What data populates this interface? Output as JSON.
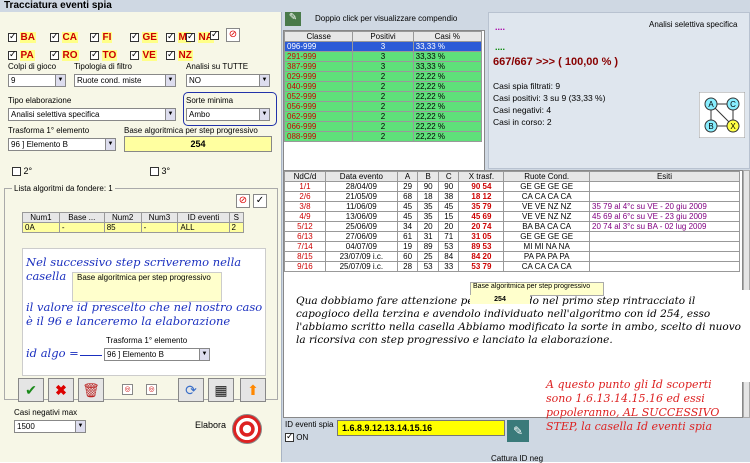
{
  "title": "Tracciatura eventi spia",
  "cities": [
    "BA",
    "CA",
    "FI",
    "GE",
    "MI",
    "NA",
    "PA",
    "RO",
    "TO",
    "VE",
    "NZ"
  ],
  "labels": {
    "colpi": "Colpi di gioco",
    "tipologia": "Tipologia di filtro",
    "analisi_tutte": "Analisi su TUTTE",
    "tipo_elab": "Tipo elaborazione",
    "sorte_min": "Sorte minima",
    "trasforma": "Trasforma 1° elemento",
    "base_alg": "Base algoritmica per step progressivo",
    "second": "2°",
    "third": "3°",
    "lista": "Lista algoritmi da fondere: 1",
    "casi_neg": "Casi negativi max",
    "elabora": "Elabora",
    "id_spia": "ID eventi spia",
    "on": "ON",
    "cattura": "Cattura ID neg",
    "dblclick": "Doppio click per visualizzare compendio",
    "analisi_sel": "Analisi selettiva specifica"
  },
  "values": {
    "colpi": "9",
    "tipologia": "Ruote cond. miste",
    "analisi_tutte": "NO",
    "tipo_elab": "Analisi selettiva specifica",
    "sorte": "Ambo",
    "trasforma": "96 ] Elemento B",
    "base": "254",
    "casi_neg": "1500",
    "id_spia": "1.6.8.9.12.13.14.15.16",
    "dots": "....",
    "result": "667/667 >>> ( 100,00 % )"
  },
  "stats": [
    "Casi spia filtrati: 9",
    "Casi positivi: 3 su 9 (33,33 %)",
    "Casi negativi: 4",
    "Casi in corso: 2"
  ],
  "algo_headers": [
    "Num1",
    "Base ...",
    "Num2",
    "Num3",
    "ID eventi",
    "S"
  ],
  "algo_row": [
    "0A",
    "-",
    "85",
    "-",
    "ALL",
    "2"
  ],
  "classe_headers": [
    "Classe",
    "Positivi",
    "Casi %"
  ],
  "classe_rows": [
    [
      "096-999",
      "3",
      "33,33 %"
    ],
    [
      "291-999",
      "3",
      "33,33 %"
    ],
    [
      "387-999",
      "3",
      "33,33 %"
    ],
    [
      "029-999",
      "2",
      "22,22 %"
    ],
    [
      "040-999",
      "2",
      "22,22 %"
    ],
    [
      "052-999",
      "2",
      "22,22 %"
    ],
    [
      "056-999",
      "2",
      "22,22 %"
    ],
    [
      "062-999",
      "2",
      "22,22 %"
    ],
    [
      "066-999",
      "2",
      "22,22 %"
    ],
    [
      "088-999",
      "2",
      "22,22 %"
    ]
  ],
  "ev_headers": [
    "NdC/d",
    "Data evento",
    "A",
    "B",
    "C",
    "X trasf.",
    "Ruote Cond.",
    "Esiti"
  ],
  "ev_rows": [
    [
      "1/1",
      "28/04/09",
      "29",
      "90",
      "90",
      "90 54",
      "GE GE GE GE",
      ""
    ],
    [
      "2/6",
      "21/05/09",
      "68",
      "18",
      "38",
      "18 12",
      "CA CA CA CA",
      ""
    ],
    [
      "3/8",
      "11/06/09",
      "45",
      "35",
      "45",
      "35 79",
      "VE VE NZ NZ",
      "35 79 al 4°c su VE - 20 giu 2009"
    ],
    [
      "4/9",
      "13/06/09",
      "45",
      "35",
      "15",
      "45 69",
      "VE VE NZ NZ",
      "45 69 al 6°c su VE - 23 giu 2009"
    ],
    [
      "5/12",
      "25/06/09",
      "34",
      "20",
      "20",
      "20 74",
      "BA BA CA CA",
      "20 74 al 3°c su BA - 02 lug 2009"
    ],
    [
      "6/13",
      "27/06/09",
      "61",
      "31",
      "71",
      "31 05",
      "GE GE GE GE",
      ""
    ],
    [
      "7/14",
      "04/07/09",
      "19",
      "89",
      "53",
      "89 53",
      "MI MI NA NA",
      ""
    ],
    [
      "8/15",
      "23/07/09 i.c.",
      "60",
      "25",
      "84",
      "84 20",
      "PA PA PA PA",
      ""
    ],
    [
      "9/16",
      "25/07/09 i.c.",
      "28",
      "53",
      "33",
      "53 79",
      "CA CA CA CA",
      ""
    ]
  ],
  "notes": {
    "left1": "Nel successivo step scriveremo nella casella",
    "left_base": "Base algoritmica per step progressivo",
    "left2": "il valore id prescelto che nel nostro caso è il 96 e lanceremo la elaborazione",
    "left_base_val": "254",
    "left_tras": "Trasforma 1° elemento",
    "left_id": "id algo =",
    "left_tras_val": "96 ] Elemento B",
    "main": "Qua dobbiamo fare attenzione perchè avendo nel primo step rintracciato il capogioco della terzina e avendolo individuato nell'algoritmo con id 254, esso l'abbiamo scritto nella casella Abbiamo modificato la sorte in ambo, scelto di nuovo la ricorsiva con step progressivo e lanciato la elaborazione.",
    "main_base": "Base algoritmica per step progressivo",
    "main_base_val": "254",
    "red": "A questo punto gli Id scoperti sono 1.6.13.14.15.16 ed essi popoleranno, AL SUCCESSIVO STEP, la casella Id eventi spia"
  },
  "diagram": [
    "A",
    "C",
    "B",
    "X"
  ]
}
